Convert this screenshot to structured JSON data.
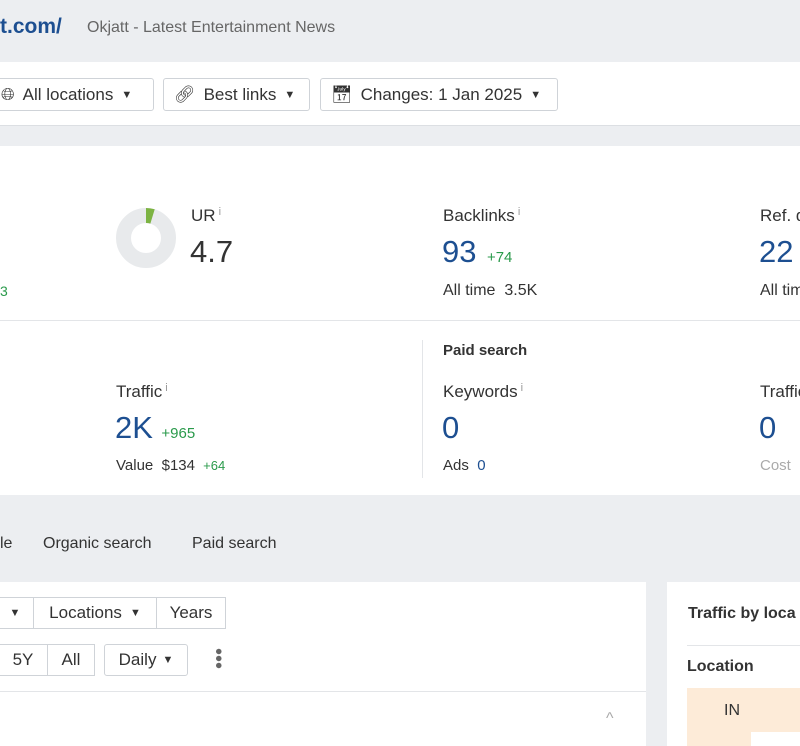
{
  "header": {
    "domain": "t.com/",
    "site_title": "Okjatt - Latest Entertainment News"
  },
  "toolbar": {
    "locations": "All locations",
    "links": "Best links",
    "changes": "Changes: 1 Jan 2025"
  },
  "metrics": {
    "left_delta": "3",
    "ur": {
      "label": "UR",
      "value": "4.7",
      "fill_percent": 4.7
    },
    "backlinks": {
      "label": "Backlinks",
      "value": "93",
      "delta": "+74",
      "sub_label": "All time",
      "sub_value": "3.5K"
    },
    "ref": {
      "label": "Ref. d",
      "value": "22",
      "sub_label": "All tim"
    },
    "traffic": {
      "label": "Traffic",
      "value": "2K",
      "delta": "+965",
      "sub_label": "Value",
      "sub_value": "$134",
      "sub_delta": "+64"
    },
    "paid": {
      "heading": "Paid search",
      "keywords_label": "Keywords",
      "keywords_value": "0",
      "ads_label": "Ads",
      "ads_value": "0",
      "traffic_label": "Traffic",
      "traffic_value": "0",
      "cost_label": "Cost"
    }
  },
  "tabs": [
    "le",
    "Organic search",
    "Paid search"
  ],
  "chart_panel": {
    "locations": "Locations",
    "years": "Years",
    "ranges": [
      "5Y",
      "All"
    ],
    "interval": "Daily"
  },
  "side_panel": {
    "title": "Traffic by loca",
    "column": "Location",
    "rows": [
      "IN"
    ]
  },
  "colors": {
    "accent": "#1d4f91",
    "positive": "#2a9a4b",
    "ur_fill": "#7cb342"
  }
}
